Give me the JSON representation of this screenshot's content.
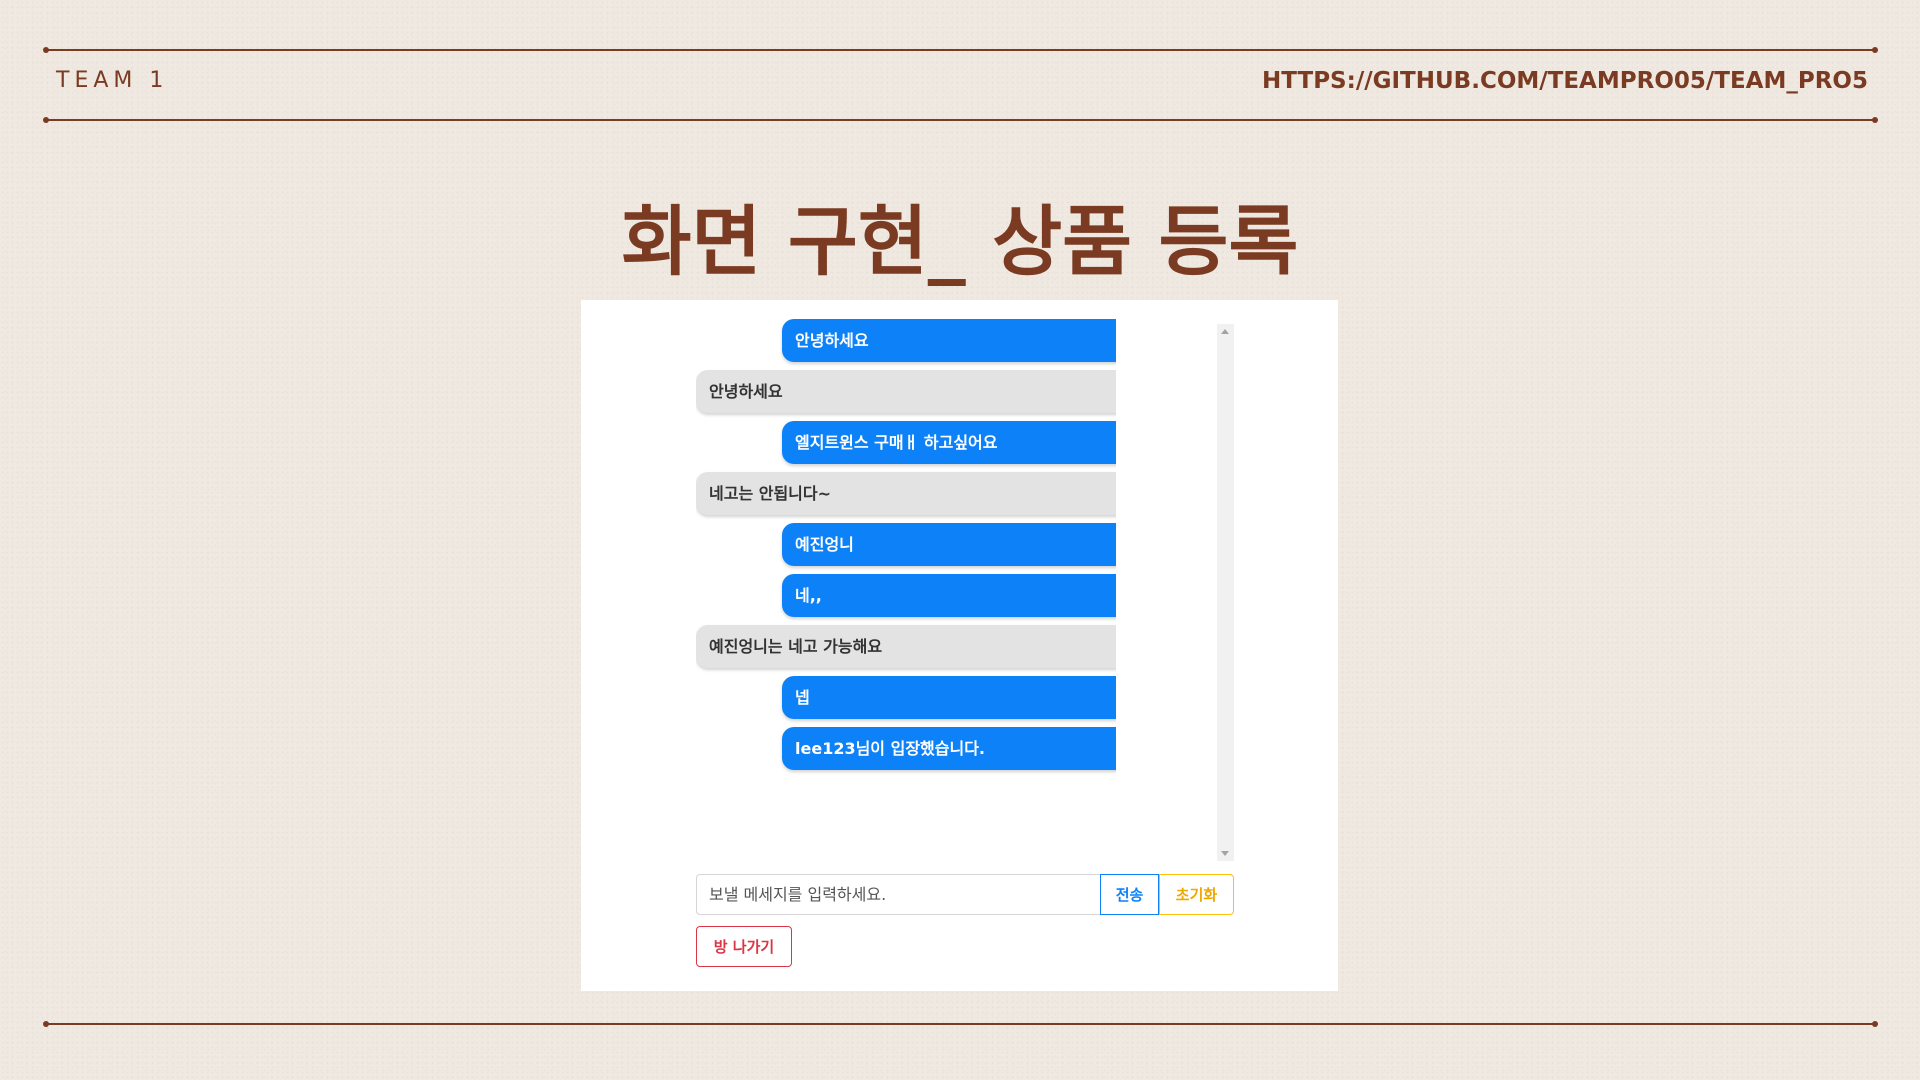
{
  "header": {
    "team": "TEAM 1",
    "url": "HTTPS://GITHUB.COM/TEAMPRO05/TEAM_PRO5"
  },
  "title": "화면 구현_ 상품 등록",
  "chat": {
    "messages": [
      {
        "side": "out",
        "text": "안녕하세요"
      },
      {
        "side": "in",
        "text": "안녕하세요"
      },
      {
        "side": "out",
        "text": "엘지트윈스 구매ㅐ 하고싶어요"
      },
      {
        "side": "in",
        "text": "네고는 안됩니다~"
      },
      {
        "side": "out",
        "text": "예진엉니"
      },
      {
        "side": "out",
        "text": "네,,"
      },
      {
        "side": "in",
        "text": "예진엉니는 네고 가능해요"
      },
      {
        "side": "out",
        "text": "넵"
      },
      {
        "side": "out",
        "text": "lee123님이 입장했습니다."
      }
    ]
  },
  "input": {
    "placeholder": "보낼 메세지를 입력하세요.",
    "send_label": "전송",
    "reset_label": "초기화"
  },
  "leave_label": "방 나가기",
  "colors": {
    "accent_brown": "#7a3b22",
    "bubble_out": "#0d82f8",
    "bubble_in": "#e3e3e3",
    "send": "#0d82f8",
    "reset": "#ffc107",
    "leave": "#dc3545"
  }
}
